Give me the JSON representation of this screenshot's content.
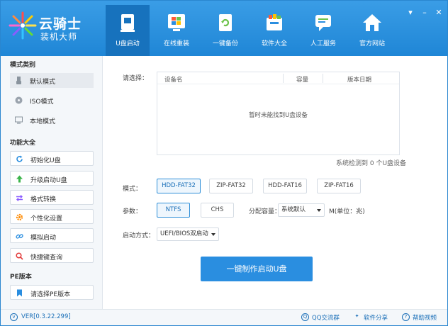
{
  "app": {
    "logo_title": "云骑士",
    "logo_subtitle": "装机大师"
  },
  "nav": [
    {
      "label": "U盘启动",
      "icon": "usb-drive-icon"
    },
    {
      "label": "在线重装",
      "icon": "windows-icon"
    },
    {
      "label": "一键备份",
      "icon": "backup-icon"
    },
    {
      "label": "软件大全",
      "icon": "software-box-icon"
    },
    {
      "label": "人工服务",
      "icon": "chat-service-icon"
    },
    {
      "label": "官方网站",
      "icon": "home-icon"
    }
  ],
  "window_controls": {
    "menu": "▾",
    "minimize": "–",
    "close": "✕"
  },
  "sidebar": {
    "mode_header": "模式类别",
    "modes": [
      {
        "label": "默认模式",
        "icon": "usb-stick-icon"
      },
      {
        "label": "ISO模式",
        "icon": "disc-icon"
      },
      {
        "label": "本地模式",
        "icon": "monitor-icon"
      }
    ],
    "functions_header": "功能大全",
    "functions": [
      {
        "label": "初始化U盘",
        "icon": "refresh-icon"
      },
      {
        "label": "升级启动U盘",
        "icon": "upgrade-arrow-icon"
      },
      {
        "label": "格式转换",
        "icon": "convert-icon"
      },
      {
        "label": "个性化设置",
        "icon": "settings-gear-icon"
      },
      {
        "label": "模拟启动",
        "icon": "link-icon"
      },
      {
        "label": "快捷键查询",
        "icon": "search-icon"
      }
    ],
    "pe_header": "PE版本",
    "pe_select": {
      "label": "请选择PE版本",
      "icon": "bookmark-icon"
    }
  },
  "main": {
    "select_label": "请选择：",
    "table": {
      "columns": [
        "设备名",
        "容量",
        "版本日期"
      ],
      "empty_message": "暂时未能找到U盘设备"
    },
    "detect_status": "系统检测到 0 个U盘设备",
    "mode_label": "模式：",
    "modes": [
      "HDD-FAT32",
      "ZIP-FAT32",
      "HDD-FAT16",
      "ZIP-FAT16"
    ],
    "params_label": "参数：",
    "params": [
      "NTFS",
      "CHS"
    ],
    "alloc_label": "分配容量：",
    "alloc_value": "系统默认",
    "alloc_unit": "M(单位：兆)",
    "boot_label": "启动方式：",
    "boot_value": "UEFI/BIOS双启动",
    "make_button": "一键制作启动U盘"
  },
  "statusbar": {
    "version": "VER[0.3.22.299]",
    "qq_group": "QQ交流群",
    "share": "软件分享",
    "help_video": "帮助视频"
  },
  "colors": {
    "brand_blue": "#2a8ee0",
    "nav_active": "#1772bd"
  }
}
